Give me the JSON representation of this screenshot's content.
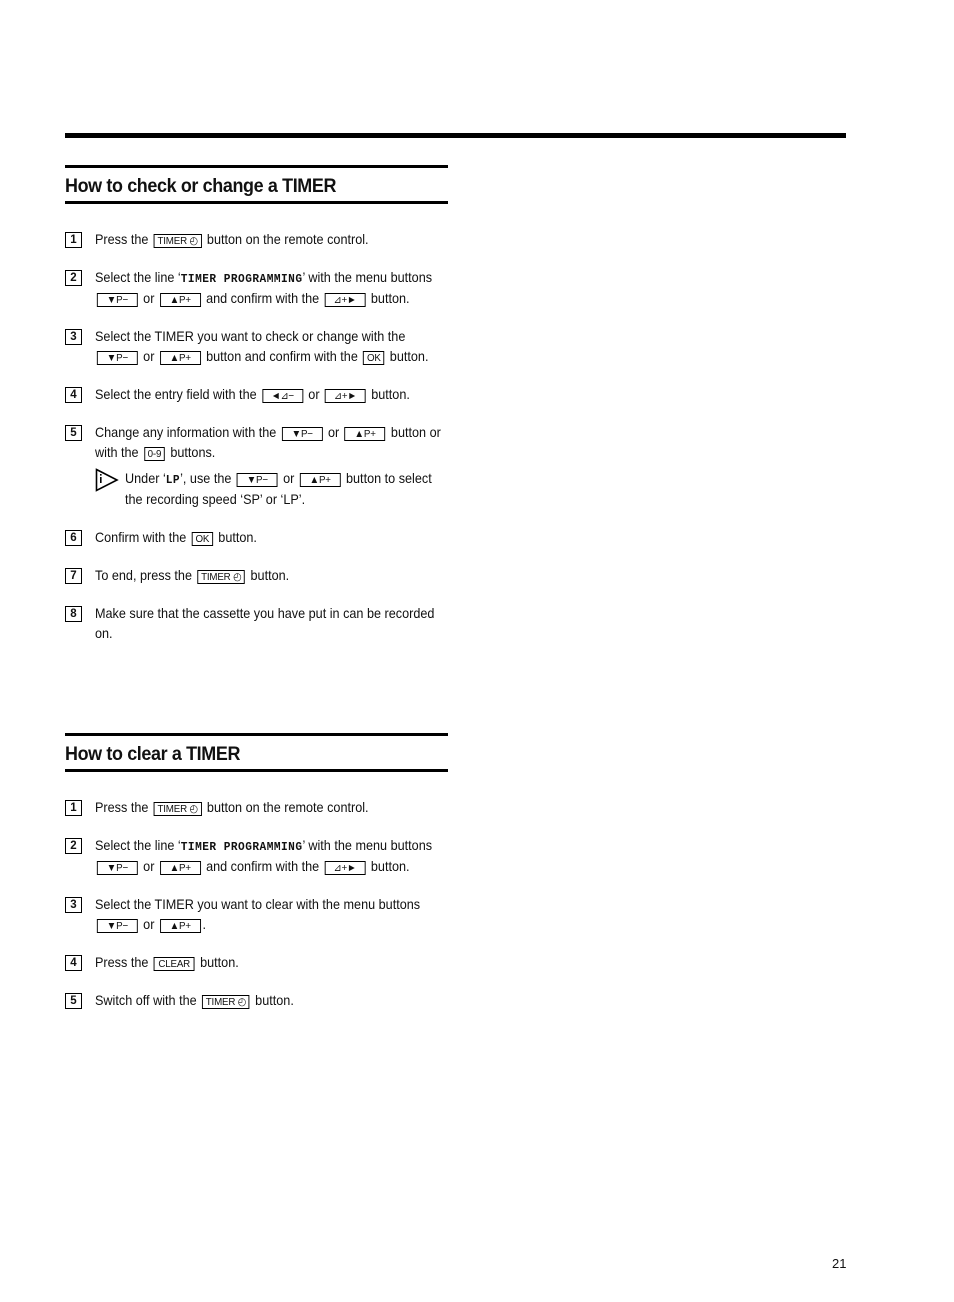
{
  "page": {
    "number": "21"
  },
  "keys": {
    "timer": "TIMER",
    "p_minus": "▼P−",
    "p_plus": "▲P+",
    "right": "⊿+►",
    "left": "◄⊿−",
    "ok": "OK",
    "digits": "0-9",
    "clear": "CLEAR"
  },
  "icons": {
    "clock": "◴"
  },
  "section1": {
    "title": "How to check or change a TIMER",
    "steps": [
      {
        "num": "1",
        "a": "Press the",
        "b": "button on the remote control."
      },
      {
        "num": "2",
        "a": "Select the line ‘",
        "osd": "TIMER PROGRAMMING",
        "b": "’ with the menu buttons",
        "or": "or",
        "c": "and confirm with the",
        "d": "button."
      },
      {
        "num": "3",
        "a": "Select the TIMER you want to check or change with the",
        "or": "or",
        "b": "button and confirm with the",
        "c": "button."
      },
      {
        "num": "4",
        "a": "Select the entry field with the",
        "or": "or",
        "b": "button."
      },
      {
        "num": "5",
        "a": "Change any information with the",
        "or": "or",
        "b": "button or with the",
        "c": "buttons.",
        "note": {
          "a": "Under ‘",
          "osd": "LP",
          "b": "’, use the",
          "or": "or",
          "c": "button to select the recording speed ‘SP’ or ‘LP’."
        }
      },
      {
        "num": "6",
        "a": "Confirm with the",
        "b": "button."
      },
      {
        "num": "7",
        "a": "To end, press the",
        "b": "button."
      },
      {
        "num": "8",
        "a": "Make sure that the cassette you have put in can be recorded on."
      }
    ]
  },
  "section2": {
    "title": "How to clear a TIMER",
    "steps": [
      {
        "num": "1",
        "a": "Press the",
        "b": "button on the remote control."
      },
      {
        "num": "2",
        "a": "Select the line ‘",
        "osd": "TIMER PROGRAMMING",
        "b": "’ with the menu buttons",
        "or": "or",
        "c": "and confirm with the",
        "d": "button."
      },
      {
        "num": "3",
        "a": "Select the TIMER you want to clear with the menu buttons",
        "or": "or",
        "b": "."
      },
      {
        "num": "4",
        "a": "Press the",
        "b": "button."
      },
      {
        "num": "5",
        "a": "Switch off with the",
        "b": "button."
      }
    ]
  }
}
